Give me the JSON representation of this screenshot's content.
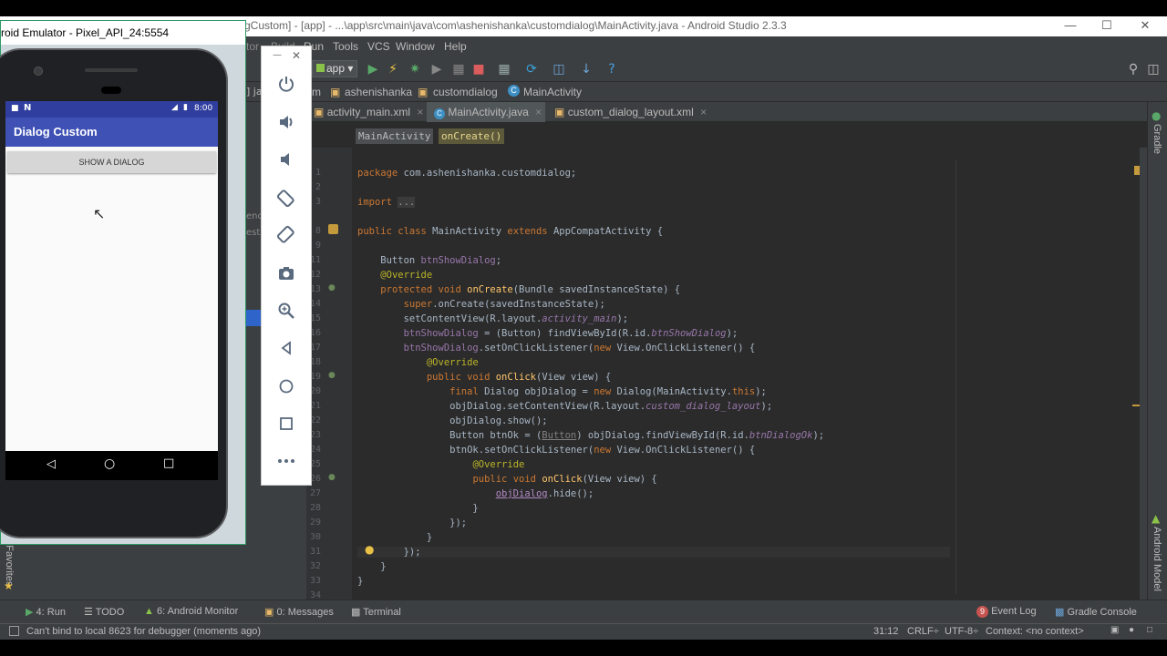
{
  "ide": {
    "title": "gCustom] - [app] - ...\\app\\src\\main\\java\\com\\ashenishanka\\customdialog\\MainActivity.java - Android Studio 2.3.3",
    "menu": [
      "Run",
      "Tools",
      "VCS",
      "Window",
      "Help"
    ],
    "menu_partial": [
      "tor",
      "Build"
    ],
    "run_config": "app",
    "breadcrumbs": [
      "m",
      "ashenishanka",
      "customdialog",
      "MainActivity"
    ],
    "tabs": [
      {
        "label": "activity_main.xml",
        "active": false
      },
      {
        "label": "MainActivity.java",
        "active": true
      },
      {
        "label": "custom_dialog_layout.xml",
        "active": false
      }
    ],
    "code_crumbs": [
      "MainActivity",
      "onCreate()"
    ],
    "right_tools": [
      "Gradle",
      "Android Model"
    ],
    "left_tools": [
      "2: Favorites"
    ],
    "bottom_tools": [
      {
        "label": "4: Run"
      },
      {
        "label": "TODO"
      },
      {
        "label": "6: Android Monitor"
      },
      {
        "label": "0: Messages"
      },
      {
        "label": "Terminal"
      },
      {
        "label": "Event Log"
      },
      {
        "label": "Gradle Console"
      }
    ],
    "status_message": "Can't bind to local 8623 for debugger (moments ago)",
    "caret_pos": "31:12",
    "line_sep": "CRLF÷",
    "encoding": "UTF-8÷",
    "context": "Context: <no context>",
    "event_badge": "9",
    "line_numbers": [
      "1",
      "2",
      "3",
      "8",
      "9",
      "10",
      "11",
      "12",
      "13",
      "14",
      "15",
      "16",
      "17",
      "18",
      "19",
      "20",
      "21",
      "22",
      "23",
      "24",
      "25",
      "26",
      "27",
      "28",
      "29",
      "30",
      "31",
      "32",
      "33",
      "34"
    ],
    "side_fragments": [
      "] ja",
      "end",
      "est"
    ]
  },
  "emulator": {
    "title": "roid Emulator - Pixel_API_24:5554",
    "clock": "8:00",
    "app_title": "Dialog Custom",
    "button_label": "SHOW A DIALOG"
  },
  "controls": [
    "power-icon",
    "volume-up-icon",
    "volume-down-icon",
    "rotate-left-icon",
    "rotate-right-icon",
    "camera-icon",
    "zoom-icon",
    "back-icon",
    "home-icon",
    "overview-icon",
    "more-icon"
  ],
  "colors": {
    "ide_bg": "#3c3f41",
    "editor_bg": "#2b2b2b",
    "keyword": "#cc7832",
    "annotation": "#bbb529",
    "method": "#ffc66d",
    "app_bar": "#3f51b5",
    "status_bar": "#303f9f"
  }
}
